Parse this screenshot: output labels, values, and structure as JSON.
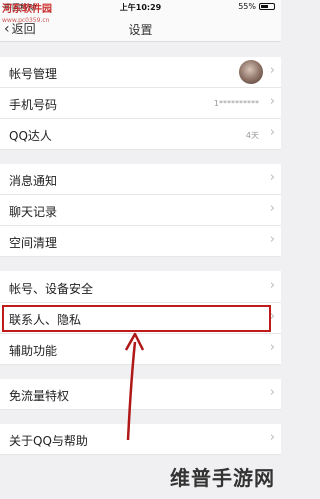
{
  "status_bar": {
    "carrier": "中国移动",
    "time": "上午10:29",
    "battery": "55%"
  },
  "watermark_top": {
    "text": "河东软件园",
    "url": "www.pc0359.cn"
  },
  "nav": {
    "back_label": "返回",
    "title": "设置"
  },
  "rows": {
    "account": "帐号管理",
    "phone": "手机号码",
    "phone_value": "1**********",
    "qq_expert": "QQ达人",
    "qq_expert_value": "4天",
    "notifications": "消息通知",
    "chat_history": "聊天记录",
    "storage": "空间清理",
    "security": "帐号、设备安全",
    "privacy": "联系人、隐私",
    "accessibility": "辅助功能",
    "data_free": "免流量特权",
    "about": "关于QQ与帮助"
  },
  "colors": {
    "highlight": "#c01b1b"
  },
  "watermark_bottom": "维普手游网"
}
